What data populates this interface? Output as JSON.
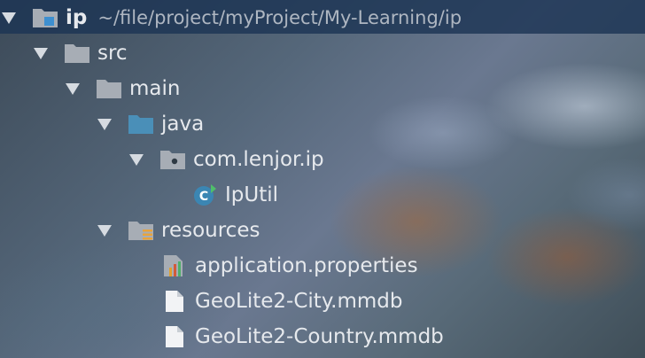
{
  "tree": {
    "root": {
      "label": "ip",
      "path": "~/file/project/myProject/My-Learning/ip"
    },
    "src": {
      "label": "src"
    },
    "main": {
      "label": "main"
    },
    "java": {
      "label": "java"
    },
    "package": {
      "label": "com.lenjor.ip"
    },
    "class": {
      "label": "IpUtil"
    },
    "resources": {
      "label": "resources"
    },
    "files": [
      {
        "label": "application.properties",
        "icon": "properties-file-icon"
      },
      {
        "label": "GeoLite2-City.mmdb",
        "icon": "file-icon"
      },
      {
        "label": "GeoLite2-Country.mmdb",
        "icon": "file-icon"
      }
    ]
  },
  "colors": {
    "folder": "#a7adb5",
    "source_folder": "#4a8fb8",
    "class_icon": "#3b86b3",
    "header_bg": "#1c3454"
  }
}
